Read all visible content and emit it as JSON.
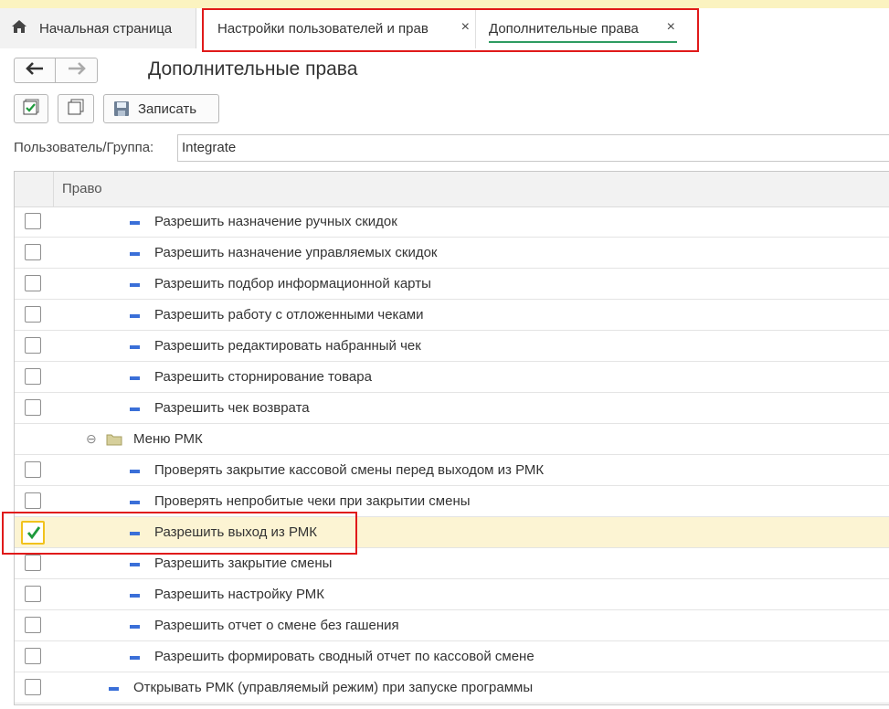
{
  "tabs": {
    "home": {
      "label": "Начальная страница",
      "icon": "home-icon"
    },
    "users": {
      "label": "Настройки пользователей и прав",
      "close": "×"
    },
    "extra": {
      "label": "Дополнительные права",
      "close": "×"
    }
  },
  "toolbar": {
    "back_icon": "arrow-left-icon",
    "forward_icon": "arrow-right-icon",
    "check_all_icon": "check-all-icon",
    "uncheck_all_icon": "copy-icon",
    "save_label": "Записать"
  },
  "page": {
    "title": "Дополнительные права"
  },
  "user_group": {
    "label": "Пользователь/Группа:",
    "value": "Integrate"
  },
  "grid": {
    "header": "Право",
    "rows": [
      {
        "text": "Разрешить назначение ручных скидок",
        "checked": false
      },
      {
        "text": "Разрешить назначение управляемых скидок",
        "checked": false
      },
      {
        "text": "Разрешить подбор информационной карты",
        "checked": false
      },
      {
        "text": "Разрешить работу с отложенными чеками",
        "checked": false
      },
      {
        "text": "Разрешить редактировать набранный чек",
        "checked": false
      },
      {
        "text": "Разрешить сторнирование товара",
        "checked": false
      },
      {
        "text": "Разрешить чек возврата",
        "checked": false
      },
      {
        "text": "Меню РМК",
        "group": true,
        "expander": "⊖"
      },
      {
        "text": "Проверять закрытие кассовой смены перед выходом из РМК",
        "checked": false
      },
      {
        "text": "Проверять непробитые чеки при закрытии смены",
        "checked": false
      },
      {
        "text": "Разрешить выход из РМК",
        "checked": true,
        "selected": true
      },
      {
        "text": "Разрешить закрытие смены",
        "checked": false
      },
      {
        "text": "Разрешить настройку РМК",
        "checked": false
      },
      {
        "text": "Разрешить отчет о смене без гашения",
        "checked": false
      },
      {
        "text": "Разрешить формировать сводный отчет по кассовой смене",
        "checked": false
      },
      {
        "text": "Открывать РМК (управляемый режим) при запуске программы",
        "checked": false
      }
    ]
  },
  "colors": {
    "accent": "#2e9b61",
    "highlight": "#e01a1a",
    "selected_row": "#fcf4d3",
    "item_marker": "#3a6fd8"
  }
}
